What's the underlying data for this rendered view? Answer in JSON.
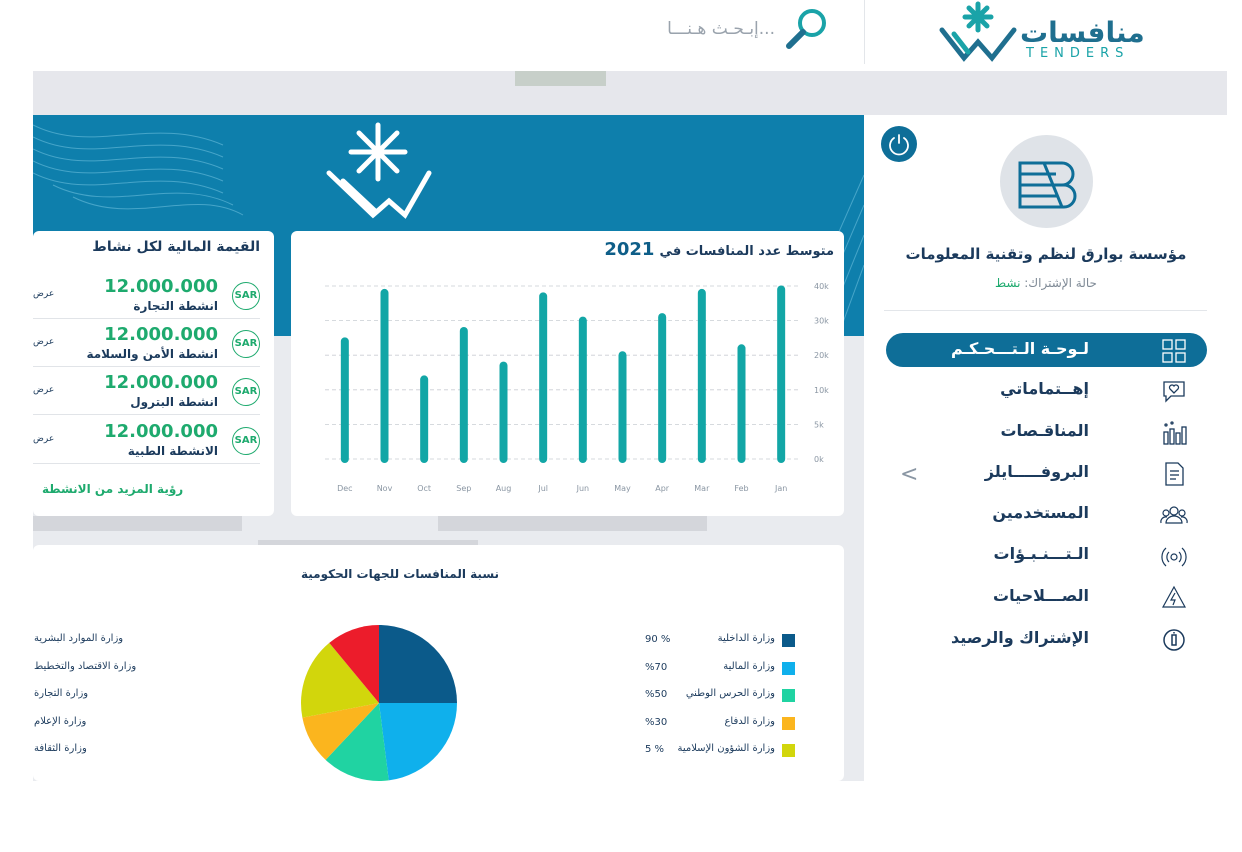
{
  "header": {
    "logo_ar": "منافسات",
    "logo_en": "TENDERS",
    "search_placeholder": "إبـحـث هـنـــا..."
  },
  "profile": {
    "org_name": "مؤسسة بوارق لنظم وتقنية المعلومات",
    "subscription_label": "حالة الإشتراك: ",
    "subscription_value": "نشط"
  },
  "sidebar": {
    "items": [
      {
        "label": "لـوحـة الـتـــحـكـم",
        "icon": "dashboard-icon",
        "active": true
      },
      {
        "label": "إهــتماماتي",
        "icon": "heart-chat-icon"
      },
      {
        "label": "المناقـصات",
        "icon": "bar-chart-icon"
      },
      {
        "label": "البروفـــــايلز",
        "icon": "document-icon"
      },
      {
        "label": "المستخدمين",
        "icon": "users-icon"
      },
      {
        "label": "الـتـــنـبـؤات",
        "icon": "signal-icon"
      },
      {
        "label": "الصـــلاحيات",
        "icon": "bolt-icon"
      },
      {
        "label": "الإشتراك والرصيد",
        "icon": "info-icon"
      }
    ],
    "collapse_glyph": "<"
  },
  "values_card": {
    "title": "القيمة المالية لكل نشاط",
    "currency": "SAR",
    "offer_label": "عرض",
    "rows": [
      {
        "amount": "12.000.000",
        "activity": "انشطة التجارة"
      },
      {
        "amount": "12.000.000",
        "activity": "انشطة الأمن والسلامة"
      },
      {
        "amount": "12.000.000",
        "activity": "انشطة البترول"
      },
      {
        "amount": "12.000.000",
        "activity": "الانشطة الطبية"
      }
    ],
    "more_link": "رؤية المزيد من الانشطة"
  },
  "colors": {
    "primary": "#0e7fac",
    "accent": "#1eaa6e",
    "bar": "#12a6a6"
  },
  "chart_data": [
    {
      "type": "bar",
      "title": "متوسط عدد المنافسات في",
      "title_year": "2021",
      "categories": [
        "Jan",
        "Feb",
        "Mar",
        "Apr",
        "May",
        "Jun",
        "Jul",
        "Aug",
        "Sep",
        "Oct",
        "Nov",
        "Dec"
      ],
      "values": [
        49,
        32,
        48,
        41,
        30,
        40,
        47,
        27,
        37,
        23,
        48,
        34
      ],
      "yticks": [
        "0k",
        "5k",
        "10k",
        "20k",
        "30k",
        "40k"
      ],
      "ylim": [
        0,
        50
      ],
      "grid": true
    },
    {
      "type": "pie",
      "title": "نسبة المنافسات للجهات الحكومية",
      "slices": [
        {
          "name": "وزارة الداخلية",
          "pct_label": "90 %",
          "value": 25,
          "color": "#0b5a8a"
        },
        {
          "name": "وزارة المالية",
          "pct_label": "%70",
          "value": 23,
          "color": "#0fb0ec"
        },
        {
          "name": "وزارة الحرس الوطني",
          "pct_label": "%50",
          "value": 14,
          "color": "#20d3a2"
        },
        {
          "name": "وزارة الدفاع",
          "pct_label": "%30",
          "value": 10,
          "color": "#fbb51e"
        },
        {
          "name": "وزارة الشؤون الإسلامية",
          "pct_label": "5 %",
          "value": 17,
          "color": "#d2d60c"
        },
        {
          "name": "",
          "pct_label": "",
          "value": 11,
          "color": "#ec1c2b"
        }
      ],
      "left_legend": [
        "وزارة الموارد البشرية",
        "وزارة الاقتصاد والتخطيط",
        "وزارة التجارة",
        "وزارة الإعلام",
        "وزارة الثقافة"
      ]
    }
  ]
}
